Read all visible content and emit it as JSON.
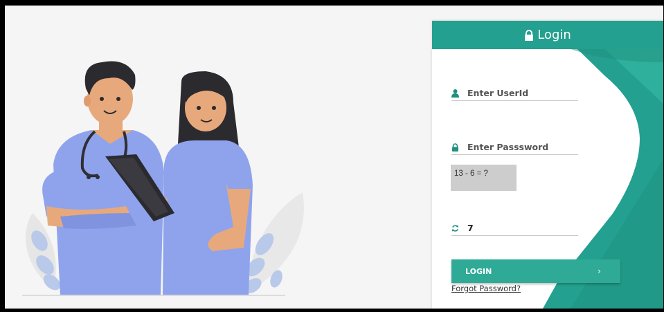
{
  "colors": {
    "accent": "#23a08f",
    "accent_dark": "#1d8e7e",
    "button": "#2eaa96",
    "captcha_bg": "#cdcdcd"
  },
  "login": {
    "title": "Login",
    "userid_placeholder": "Enter UserId",
    "password_placeholder": "Enter Passsword",
    "captcha_question": "13 - 6 = ?",
    "captcha_answer": "7",
    "button_label": "LOGIN",
    "button_chevron": "›",
    "forgot_label": "Forgot Password?"
  },
  "icons": {
    "title": "lock-icon",
    "userid": "user-icon",
    "password": "lock-icon",
    "captcha": "refresh-icon"
  }
}
